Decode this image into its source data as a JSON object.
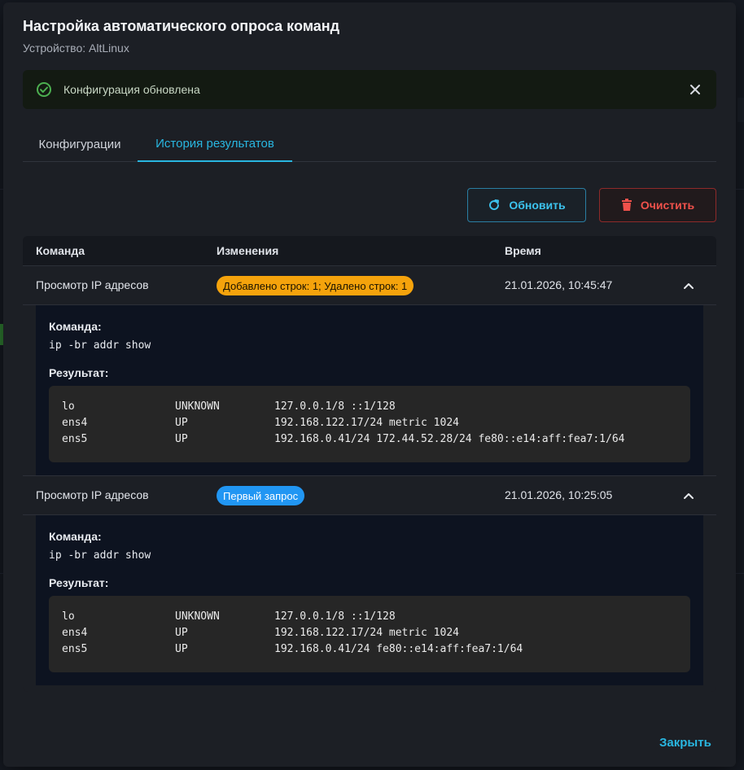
{
  "dialog": {
    "title": "Настройка автоматического опроса команд",
    "subtitle": "Устройство: AltLinux",
    "close_label": "Закрыть"
  },
  "alert": {
    "message": "Конфигурация обновлена",
    "icon": "check-circle-icon",
    "color": "#4caf50"
  },
  "tabs": [
    {
      "label": "Конфигурации",
      "active": false
    },
    {
      "label": "История результатов",
      "active": true
    }
  ],
  "actions": {
    "refresh_label": "Обновить",
    "clear_label": "Очистить"
  },
  "table": {
    "headers": [
      "Команда",
      "Изменения",
      "Время"
    ],
    "rows": [
      {
        "command_name": "Просмотр IP адресов",
        "change": "Добавлено строк: 1; Удалено строк: 1",
        "change_color": "#f5a30c",
        "time": "21.01.2026, 10:45:47",
        "expanded": true,
        "command_label": "Команда:",
        "command": "ip -br addr show",
        "result_label": "Результат:",
        "result": [
          [
            "lo",
            "UNKNOWN",
            "127.0.0.1/8 ::1/128"
          ],
          [
            "ens4",
            "UP",
            "192.168.122.17/24 metric 1024"
          ],
          [
            "ens5",
            "UP",
            "192.168.0.41/24 172.44.52.28/24 fe80::e14:aff:fea7:1/64"
          ]
        ]
      },
      {
        "command_name": "Просмотр IP адресов",
        "change": "Первый запрос",
        "change_color": "#2196f3",
        "time": "21.01.2026, 10:25:05",
        "expanded": true,
        "command_label": "Команда:",
        "command": "ip -br addr show",
        "result_label": "Результат:",
        "result": [
          [
            "lo",
            "UNKNOWN",
            "127.0.0.1/8 ::1/128"
          ],
          [
            "ens4",
            "UP",
            "192.168.122.17/24 metric 1024"
          ],
          [
            "ens5",
            "UP",
            "192.168.0.41/24 fe80::e14:aff:fea7:1/64"
          ]
        ]
      }
    ]
  }
}
